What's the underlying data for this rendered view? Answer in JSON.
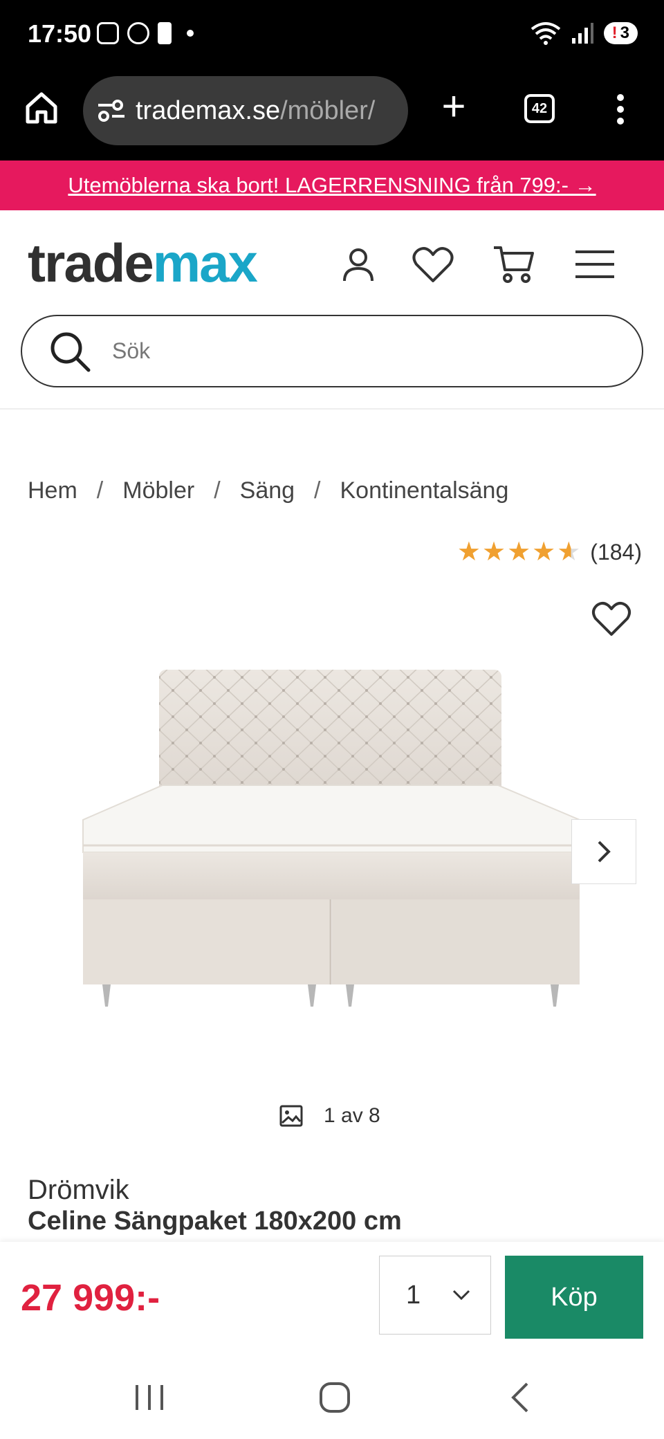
{
  "status": {
    "time": "17:50",
    "signal_label": "5",
    "notification_count": "3",
    "icons": [
      "screenshot-icon",
      "whatsapp-icon",
      "battery-alert-icon",
      "dot-icon",
      "wifi-icon",
      "signal-icon"
    ]
  },
  "browser": {
    "url_domain": "trademax.se",
    "url_path": "/möbler/",
    "tab_count": "42",
    "icons": [
      "home-icon",
      "site-settings-icon",
      "plus-icon",
      "tabs-icon",
      "overflow-menu-icon"
    ]
  },
  "promo": {
    "text": "Utemöblerna ska bort! LAGERRENSNING från 799:- →"
  },
  "header": {
    "logo_part1": "trade",
    "logo_part2": "max",
    "icons": [
      "account-icon",
      "heart-icon",
      "cart-icon",
      "hamburger-menu-icon"
    ]
  },
  "search": {
    "placeholder": "Sök"
  },
  "breadcrumb": {
    "items": [
      "Hem",
      "Möbler",
      "Säng",
      "Kontinentalsäng"
    ],
    "separator": "/"
  },
  "rating": {
    "stars": 4.6,
    "count": "(184)"
  },
  "gallery": {
    "counter": "1 av 8"
  },
  "product": {
    "brand": "Drömvik",
    "title": "Celine Sängpaket 180x200 cm"
  },
  "buy": {
    "price": "27 999:-",
    "quantity": "1",
    "button_label": "Köp"
  },
  "colors": {
    "promo": "#e6195e",
    "logo_accent": "#1aa6c8",
    "price": "#e0213f",
    "buy_button": "#1a8a66",
    "star": "#f0a030"
  }
}
